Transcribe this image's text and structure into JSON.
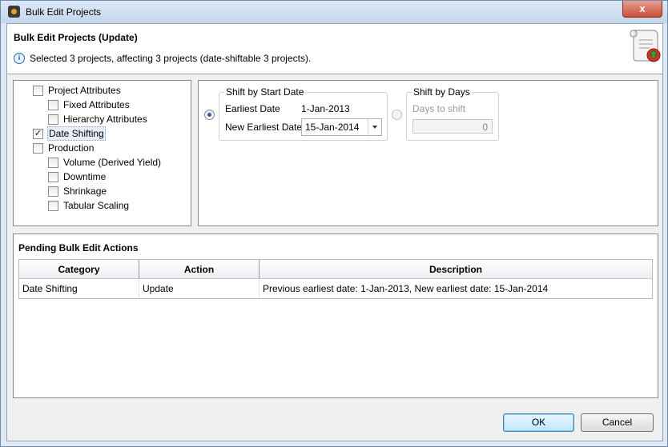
{
  "window": {
    "title": "Bulk Edit Projects",
    "close_label": "x"
  },
  "header": {
    "title": "Bulk Edit Projects (Update)",
    "info_icon": "info-icon",
    "message": "Selected 3 projects, affecting 3 projects (date-shiftable 3 projects)."
  },
  "tree": {
    "items": [
      {
        "label": "Project Attributes",
        "checked": false
      },
      {
        "label": "Fixed Attributes",
        "checked": false
      },
      {
        "label": "Hierarchy Attributes",
        "checked": false
      },
      {
        "label": "Date Shifting",
        "checked": true
      },
      {
        "label": "Production",
        "checked": false
      },
      {
        "label": "Volume (Derived Yield)",
        "checked": false
      },
      {
        "label": "Downtime",
        "checked": false
      },
      {
        "label": "Shrinkage",
        "checked": false
      },
      {
        "label": "Tabular Scaling",
        "checked": false
      }
    ]
  },
  "shift_start": {
    "legend": "Shift by Start Date",
    "earliest_label": "Earliest Date",
    "earliest_value": "1-Jan-2013",
    "new_label": "New Earliest Date",
    "new_value": "15-Jan-2014",
    "selected": true
  },
  "shift_days": {
    "legend": "Shift by Days",
    "days_label": "Days to shift",
    "days_value": "0",
    "selected": false
  },
  "pending": {
    "title": "Pending Bulk Edit Actions",
    "columns": [
      "Category",
      "Action",
      "Description"
    ],
    "rows": [
      [
        "Date Shifting",
        "Update",
        "Previous earliest date: 1-Jan-2013, New earliest date: 15-Jan-2014"
      ]
    ]
  },
  "buttons": {
    "ok": "OK",
    "cancel": "Cancel"
  },
  "colors": {
    "header_bg": "#ffffff",
    "default_button": "#bee6fd",
    "radio_selected": "#2a5fa8"
  }
}
